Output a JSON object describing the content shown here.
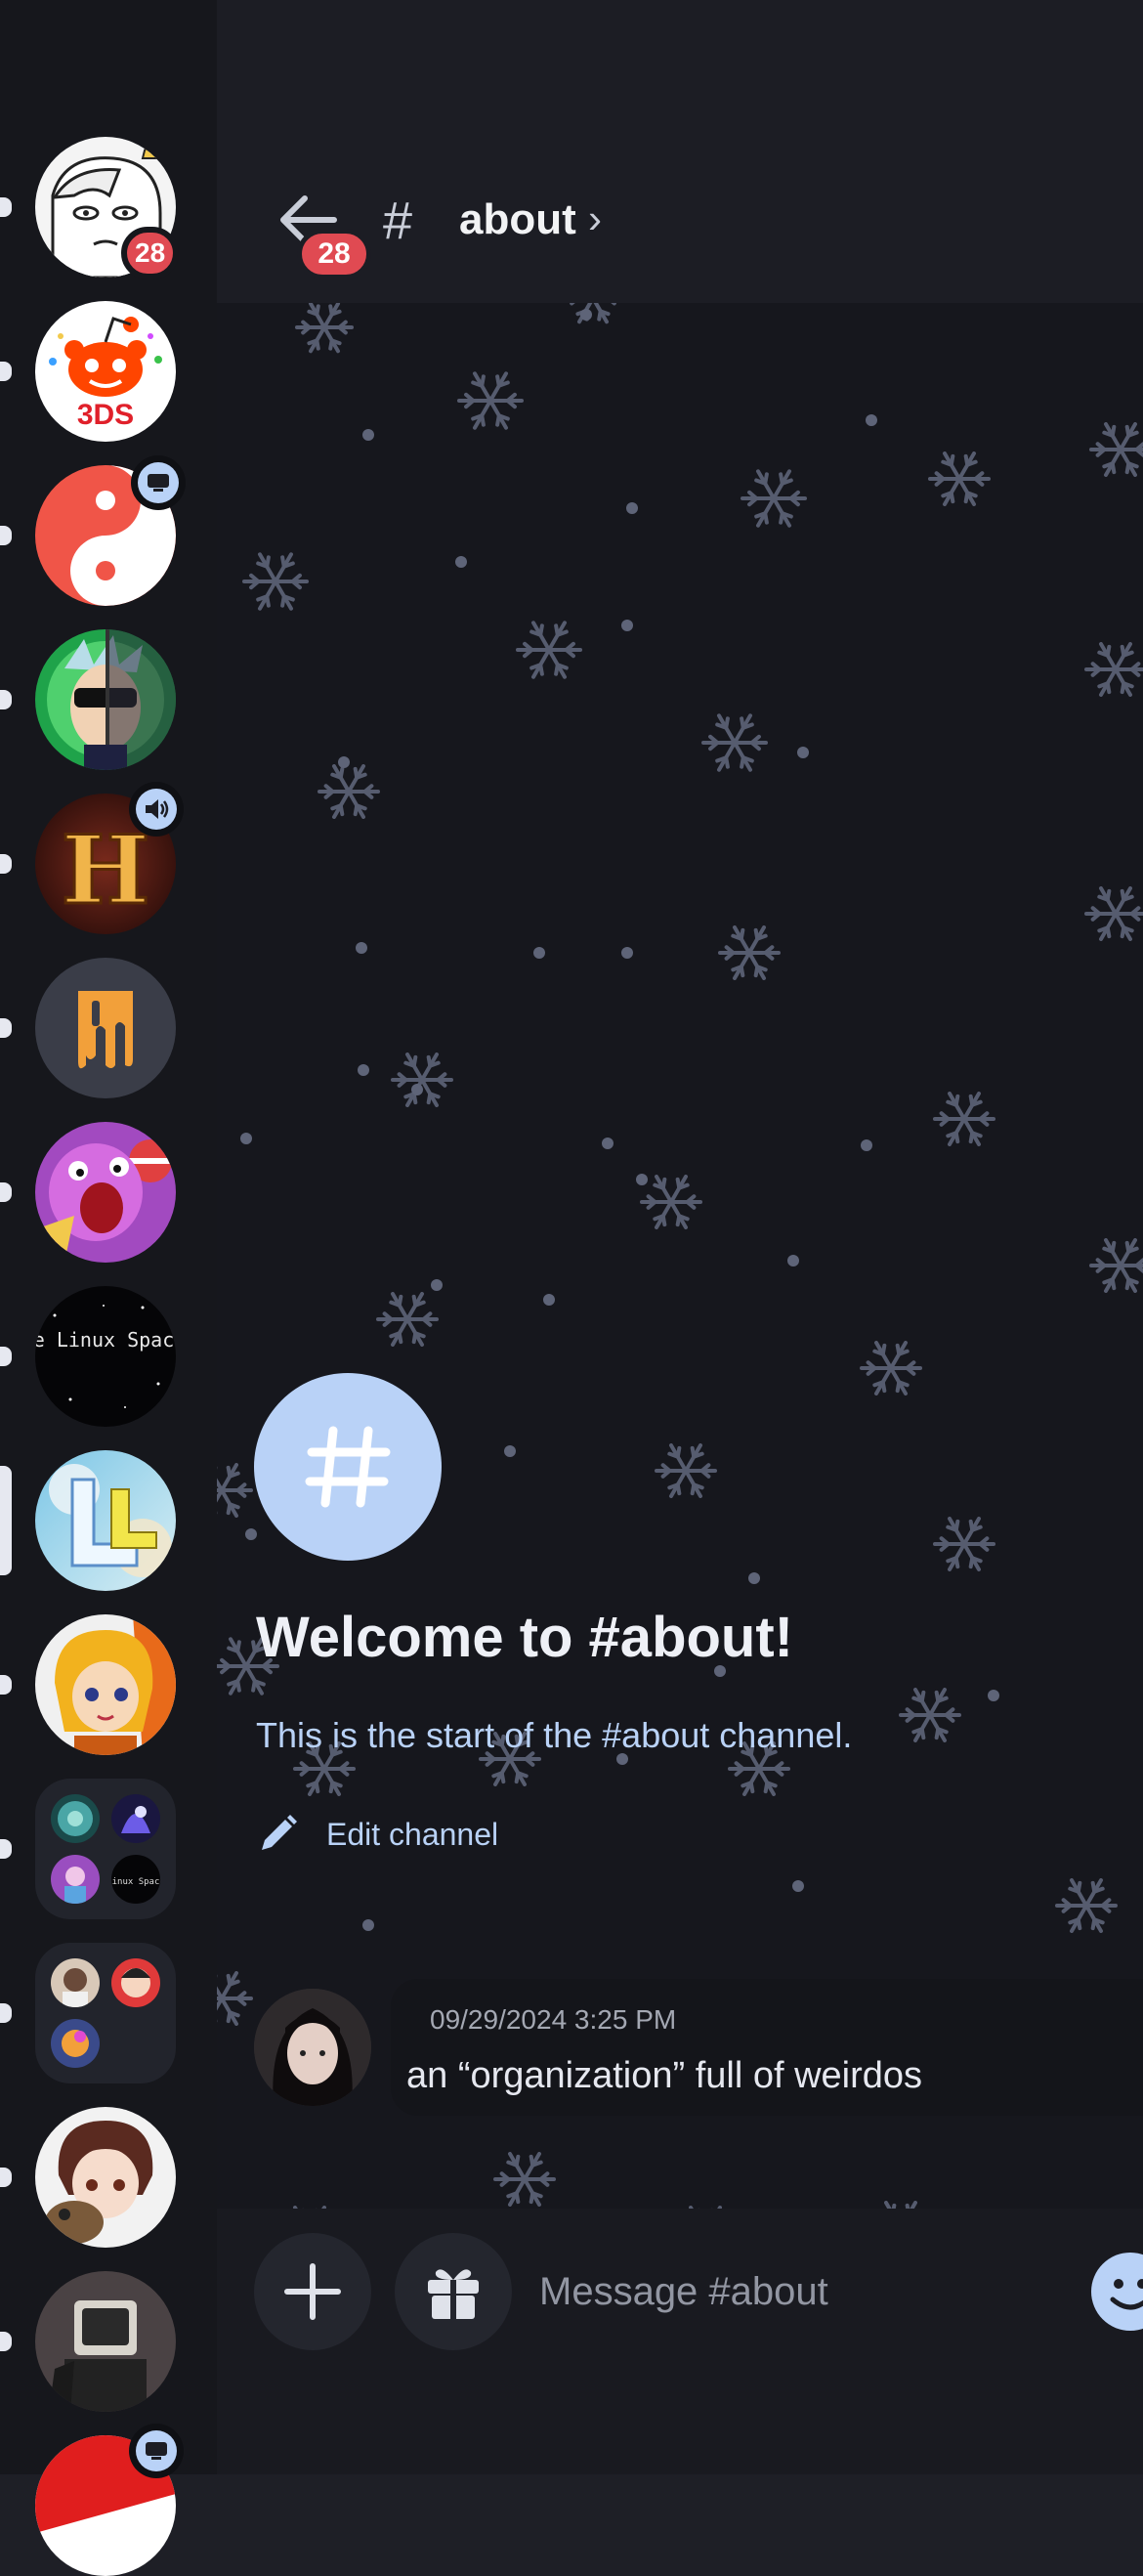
{
  "servers": [
    {
      "name": "server-1",
      "badge": "28"
    },
    {
      "name": "server-reddit-3ds",
      "logo_text": "3DS"
    },
    {
      "name": "server-yin-yang"
    },
    {
      "name": "server-rick"
    },
    {
      "name": "server-hypixel",
      "logo_text": "H"
    },
    {
      "name": "server-m"
    },
    {
      "name": "server-pokemon"
    },
    {
      "name": "server-linux-space",
      "logo_text": "The Linux Space"
    },
    {
      "name": "server-l",
      "logo_text": "L"
    },
    {
      "name": "server-anime"
    },
    {
      "name": "folder-1",
      "mini_label": "Linux Space"
    },
    {
      "name": "folder-2"
    },
    {
      "name": "server-anime-boy"
    },
    {
      "name": "server-tv-head"
    },
    {
      "name": "server-red"
    }
  ],
  "header": {
    "back_badge": "28",
    "hash": "#",
    "channel_name": "about",
    "chevron": "›"
  },
  "welcome": {
    "title": "Welcome to #about!",
    "subtitle": "This is the start of the #about channel.",
    "edit_label": "Edit channel"
  },
  "message": {
    "timestamp": "09/29/2024 3:25 PM",
    "text": "an “organization” full of weirdos"
  },
  "composer": {
    "placeholder": "Message #about"
  },
  "colors": {
    "accent": "#b9d2f7",
    "badge": "#e04a52",
    "rail_bg": "#16171c",
    "chat_bg": "#16171d"
  }
}
